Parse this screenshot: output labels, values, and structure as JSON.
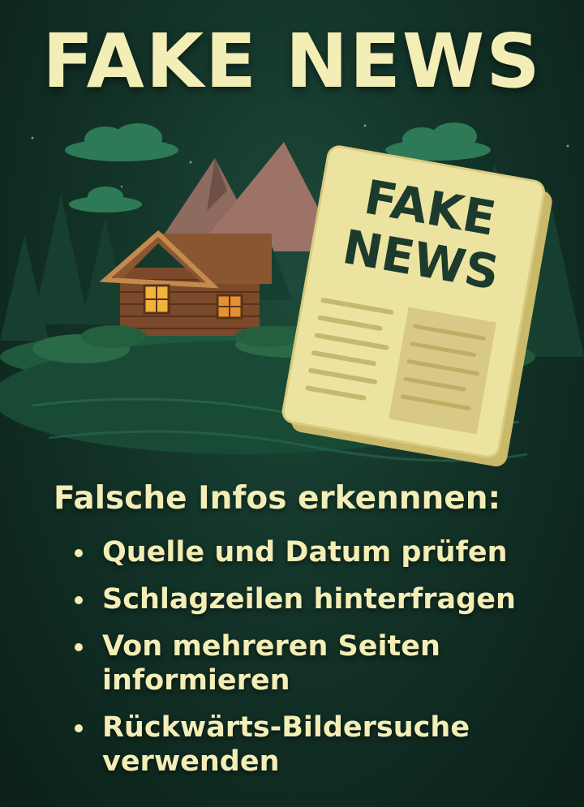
{
  "poster": {
    "title": "FAKE NEWS",
    "newspaper_headline_line1": "FAKE",
    "newspaper_headline_line2": "NEWS",
    "headline": "Falsche Infos erkennnen:",
    "bullets": [
      {
        "text": "Quelle und Datum prüfen"
      },
      {
        "text": "Schlagzeilen hinterfragen"
      },
      {
        "text": "Von mehreren Seiten informieren"
      },
      {
        "text": "Rückwärts-Bildersuche verwenden"
      }
    ]
  },
  "colors": {
    "background": "#133328",
    "text": "#f3edb6",
    "newspaper": "#ede3a1",
    "cabin": "#7a4a2a",
    "window_light": "#f2b33c"
  }
}
